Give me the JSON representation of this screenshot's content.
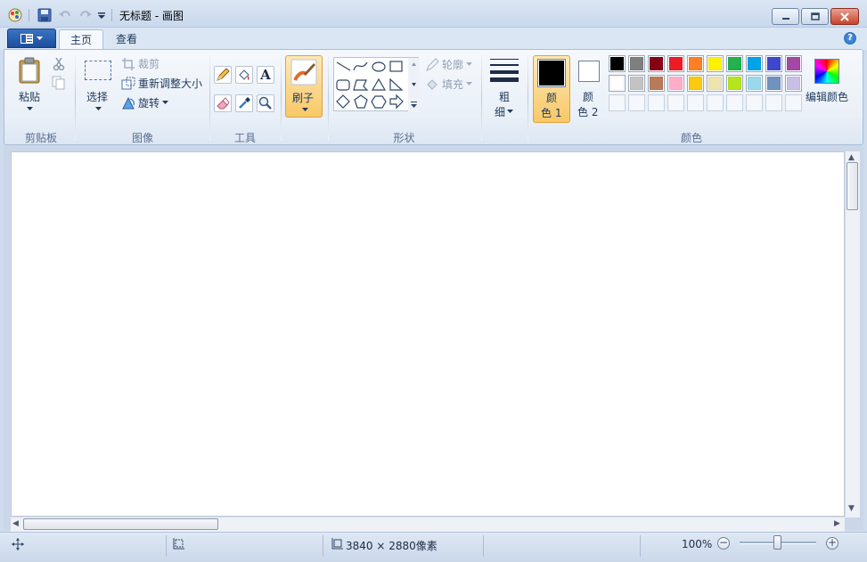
{
  "window": {
    "title": "无标题 - 画图"
  },
  "tabs": {
    "home": "主页",
    "view": "查看"
  },
  "help_label": "?",
  "clipboard": {
    "paste": "粘贴",
    "group": "剪贴板"
  },
  "image": {
    "select": "选择",
    "crop": "裁剪",
    "resize": "重新调整大小",
    "rotate": "旋转",
    "group": "图像"
  },
  "tools": {
    "group": "工具",
    "text_glyph": "A"
  },
  "brushes": {
    "label": "刷子"
  },
  "shapes": {
    "outline": "轮廓",
    "fill": "填充",
    "group": "形状"
  },
  "size": {
    "label_1": "粗",
    "label_2": "细"
  },
  "colors": {
    "color1_a": "颜",
    "color1_b": "色 1",
    "color2_a": "颜",
    "color2_b": "色 2",
    "edit": "编辑颜色",
    "group": "颜色",
    "color1_value": "#000000",
    "color2_value": "#ffffff",
    "palette_row1": [
      "#000000",
      "#7f7f7f",
      "#880015",
      "#ed1c24",
      "#ff7f27",
      "#fff200",
      "#22b14c",
      "#00a2e8",
      "#3f48cc",
      "#a349a4"
    ],
    "palette_row2": [
      "#ffffff",
      "#c3c3c3",
      "#b97a57",
      "#ffaec9",
      "#ffc90e",
      "#efe4b0",
      "#b5e61d",
      "#99d9ea",
      "#7092be",
      "#c8bfe7"
    ]
  },
  "status": {
    "dimensions": "3840 × 2880像素",
    "zoom": "100%"
  }
}
